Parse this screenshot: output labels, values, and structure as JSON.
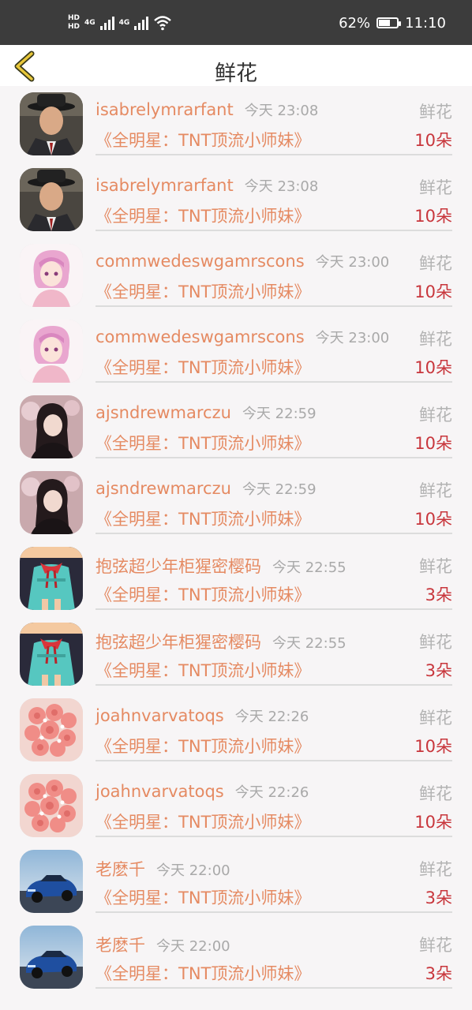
{
  "status": {
    "hd1": "HD",
    "hd2": "HD",
    "net1": "4G",
    "net2": "4G",
    "battery": "62%",
    "battery_level": 0.62,
    "time": "11:10"
  },
  "header": {
    "title": "鲜花"
  },
  "items": [
    {
      "user": "isabrelymrarfant",
      "time": "今天 23:08",
      "type": "鲜花",
      "book": "《全明星：TNT顶流小师妹》",
      "count": "10朵",
      "avatar": "man-hat"
    },
    {
      "user": "isabrelymrarfant",
      "time": "今天 23:08",
      "type": "鲜花",
      "book": "《全明星：TNT顶流小师妹》",
      "count": "10朵",
      "avatar": "man-hat"
    },
    {
      "user": "commwedeswgamrscons",
      "time": "今天 23:00",
      "type": "鲜花",
      "book": "《全明星：TNT顶流小师妹》",
      "count": "10朵",
      "avatar": "pink-girl"
    },
    {
      "user": "commwedeswgamrscons",
      "time": "今天 23:00",
      "type": "鲜花",
      "book": "《全明星：TNT顶流小师妹》",
      "count": "10朵",
      "avatar": "pink-girl"
    },
    {
      "user": "ajsndrewmarczu",
      "time": "今天 22:59",
      "type": "鲜花",
      "book": "《全明星：TNT顶流小师妹》",
      "count": "10朵",
      "avatar": "dark-girl"
    },
    {
      "user": "ajsndrewmarczu",
      "time": "今天 22:59",
      "type": "鲜花",
      "book": "《全明星：TNT顶流小师妹》",
      "count": "10朵",
      "avatar": "dark-girl"
    },
    {
      "user": "抱弦超少年柜猩密樱码",
      "time": "今天 22:55",
      "type": "鲜花",
      "book": "《全明星：TNT顶流小师妹》",
      "count": "3朵",
      "avatar": "teal-girl"
    },
    {
      "user": "抱弦超少年柜猩密樱码",
      "time": "今天 22:55",
      "type": "鲜花",
      "book": "《全明星：TNT顶流小师妹》",
      "count": "3朵",
      "avatar": "teal-girl"
    },
    {
      "user": "joahnvarvatoqs",
      "time": "今天 22:26",
      "type": "鲜花",
      "book": "《全明星：TNT顶流小师妹》",
      "count": "10朵",
      "avatar": "roses"
    },
    {
      "user": "joahnvarvatoqs",
      "time": "今天 22:26",
      "type": "鲜花",
      "book": "《全明星：TNT顶流小师妹》",
      "count": "10朵",
      "avatar": "roses"
    },
    {
      "user": "老麽千",
      "time": "今天 22:00",
      "type": "鲜花",
      "book": "《全明星：TNT顶流小师妹》",
      "count": "3朵",
      "avatar": "car"
    },
    {
      "user": "老麽千",
      "time": "今天 22:00",
      "type": "鲜花",
      "book": "《全明星：TNT顶流小师妹》",
      "count": "3朵",
      "avatar": "car"
    }
  ]
}
